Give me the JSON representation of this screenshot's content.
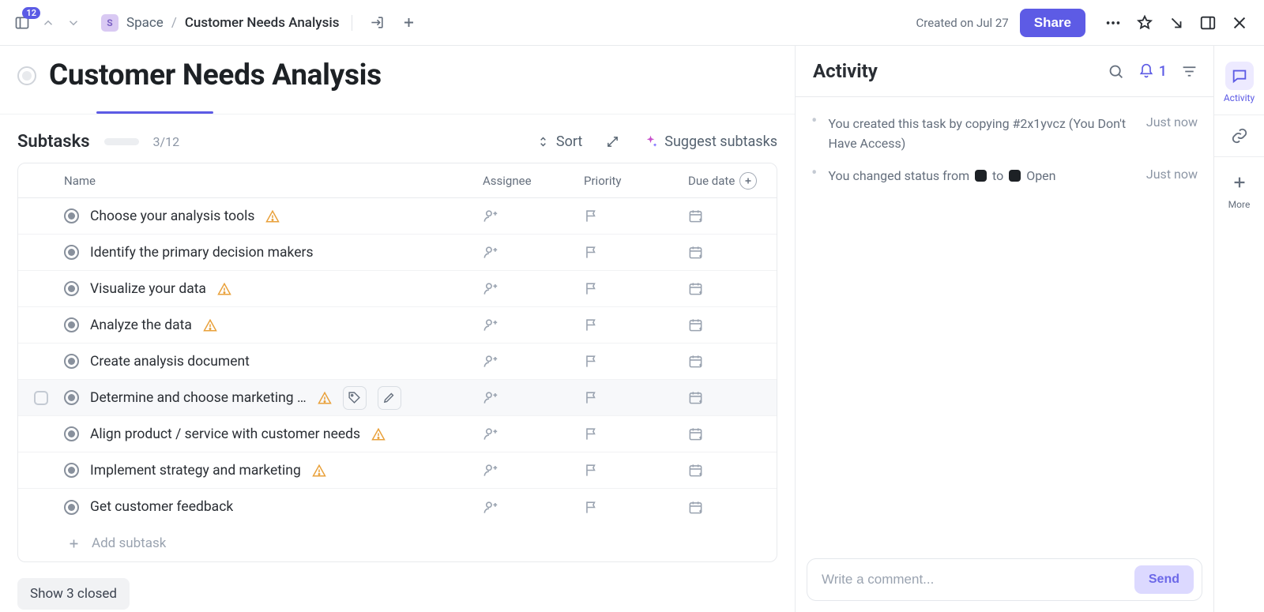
{
  "topbar": {
    "badge": "12",
    "space_letter": "S",
    "space_label": "Space",
    "sep": "/",
    "current": "Customer Needs Analysis",
    "created_label": "Created on Jul 27",
    "share_label": "Share"
  },
  "page": {
    "title": "Customer Needs Analysis"
  },
  "subtasks": {
    "heading": "Subtasks",
    "progress_text": "3/12",
    "progress_pct": 25,
    "sort_label": "Sort",
    "suggest_label": "Suggest subtasks",
    "columns": {
      "name": "Name",
      "assignee": "Assignee",
      "priority": "Priority",
      "due": "Due date"
    },
    "add_label": "Add subtask",
    "show_closed": "Show 3 closed",
    "rows": [
      {
        "name": "Choose your analysis tools",
        "warn": true
      },
      {
        "name": "Identify the primary decision makers",
        "warn": false
      },
      {
        "name": "Visualize your data",
        "warn": true
      },
      {
        "name": "Analyze the data",
        "warn": true
      },
      {
        "name": "Create analysis document",
        "warn": false
      },
      {
        "name": "Determine and choose marketing …",
        "warn": true,
        "hover": true
      },
      {
        "name": "Align product / service with customer needs",
        "warn": true
      },
      {
        "name": "Implement strategy and marketing",
        "warn": true
      },
      {
        "name": "Get customer feedback",
        "warn": false
      }
    ]
  },
  "activity": {
    "title": "Activity",
    "bell_count": "1",
    "items": [
      {
        "text_before": "You created this task by copying #2x1yvcz (You Don't Have Access)",
        "status": false,
        "time": "Just now"
      },
      {
        "text_before": "You changed status from ",
        "status": true,
        "status_to": " to ",
        "status_label": " Open",
        "time": "Just now"
      }
    ],
    "comment_placeholder": "Write a comment...",
    "send_label": "Send"
  },
  "rail": {
    "activity": "Activity",
    "more": "More"
  }
}
